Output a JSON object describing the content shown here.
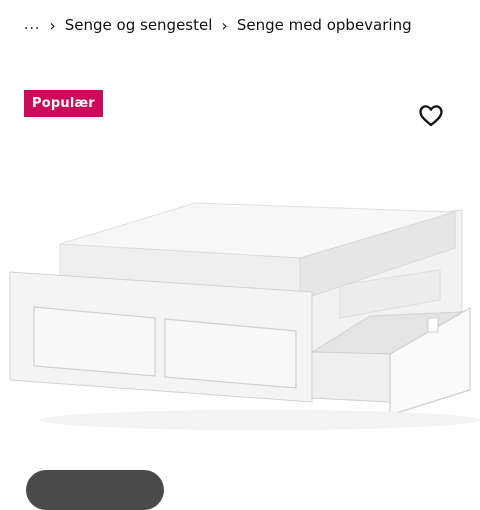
{
  "breadcrumb": {
    "ellipsis": "...",
    "items": [
      "Senge og sengestel",
      "Senge med opbevaring"
    ]
  },
  "badge": {
    "label": "Populær",
    "color": "#cc0a5a"
  },
  "icons": {
    "favorite": "heart-outline-icon",
    "separator": "chevron-right-icon"
  }
}
